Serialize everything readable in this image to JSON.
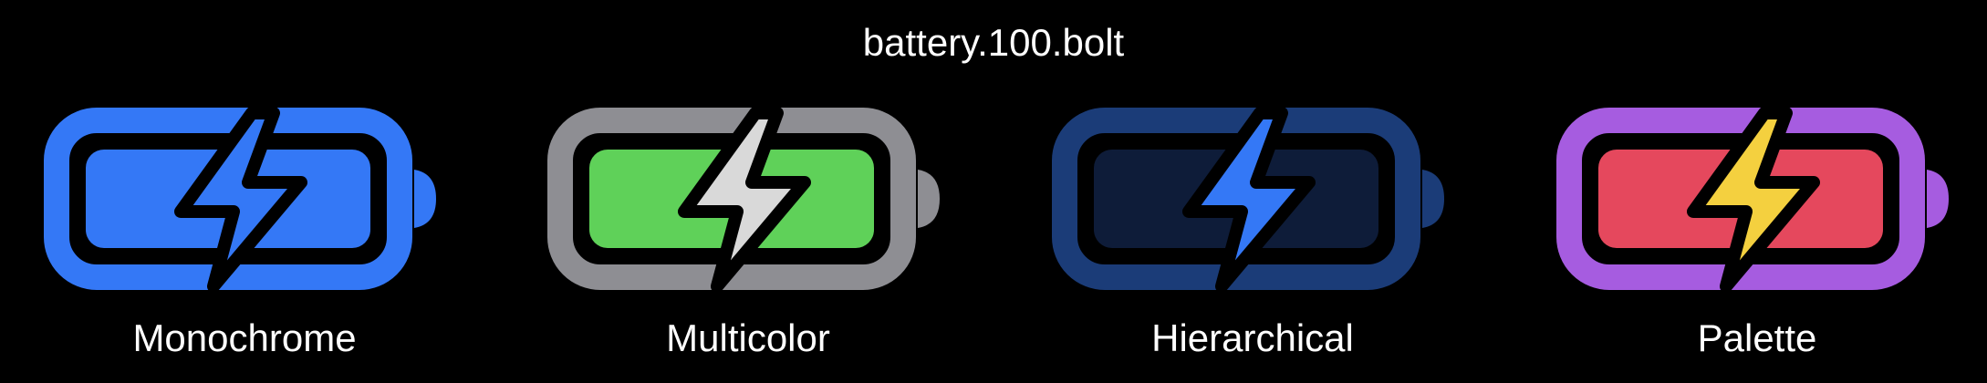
{
  "title": "battery.100.bolt",
  "variants": [
    {
      "label": "Monochrome",
      "icon": "battery-100-bolt-icon",
      "outline": "#3478f6",
      "fill": "#3478f6",
      "bolt": "#3478f6"
    },
    {
      "label": "Multicolor",
      "icon": "battery-100-bolt-icon",
      "outline": "#8e8e93",
      "fill": "#5fd159",
      "bolt": "#d9d9d9"
    },
    {
      "label": "Hierarchical",
      "icon": "battery-100-bolt-icon",
      "outline": "#1b3c78",
      "fill": "#0e1c39",
      "bolt": "#3478f6"
    },
    {
      "label": "Palette",
      "icon": "battery-100-bolt-icon",
      "outline": "#a65ce0",
      "fill": "#e5485d",
      "bolt": "#f4d03f"
    }
  ]
}
